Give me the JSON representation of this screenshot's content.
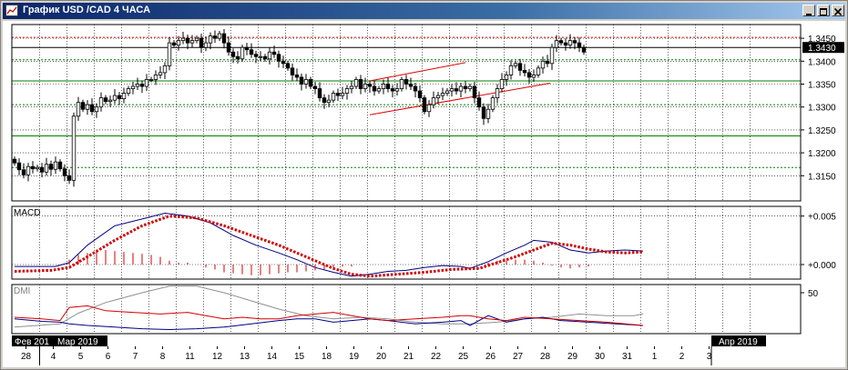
{
  "window": {
    "title": "График USD /CAD  4 ЧАСА",
    "buttons": [
      "minimize-icon",
      "maximize-icon",
      "close-icon"
    ]
  },
  "colors": {
    "background": "#ffffff",
    "bull_candle": "#ffffff",
    "bear_candle": "#000000",
    "resistance_line": "#e00000",
    "support_lines": "#008000",
    "channel_lines": "#e00000",
    "macd_line": "#000080",
    "macd_signal": "#d00000",
    "macd_histogram": "#d00000",
    "dmi_plus": "#000080",
    "dmi_minus": "#d00000",
    "adx": "#909090",
    "current_price_box": "#000000"
  },
  "chart_data": [
    {
      "type": "candlestick",
      "panel": "price",
      "ylim": [
        1.3095,
        1.348
      ],
      "y_ticks": [
        "1.3450",
        "1.3400",
        "1.3350",
        "1.3300",
        "1.3250",
        "1.3200",
        "1.3150"
      ],
      "current_price": "1.3430",
      "horizontal_lines": [
        {
          "value": 1.3452,
          "style": "dotted-red"
        },
        {
          "value": 1.343,
          "style": "solid-black"
        },
        {
          "value": 1.3403,
          "style": "dotted-green"
        },
        {
          "value": 1.3357,
          "style": "solid-green"
        },
        {
          "value": 1.3305,
          "style": "dotted-green"
        },
        {
          "value": 1.3237,
          "style": "solid-green"
        },
        {
          "value": 1.3168,
          "style": "dotted-green"
        }
      ],
      "channel": [
        {
          "from": [
            13.0,
            1.3357
          ],
          "to": [
            16.5,
            1.3397
          ]
        },
        {
          "from": [
            13.0,
            1.3283
          ],
          "to": [
            19.6,
            1.3352
          ]
        }
      ],
      "day_centers": [
        28,
        4,
        5,
        6,
        7,
        8,
        11,
        12,
        13,
        14,
        15,
        18,
        19,
        20,
        21,
        22,
        25,
        26,
        27,
        28,
        29
      ],
      "candles_per_day": 6,
      "closes": [
        1.3178,
        1.3163,
        1.3152,
        1.317,
        1.3165,
        1.3168,
        1.3158,
        1.3175,
        1.3164,
        1.318,
        1.3165,
        1.315,
        1.314,
        1.328,
        1.331,
        1.3295,
        1.3305,
        1.329,
        1.33,
        1.332,
        1.3312,
        1.3315,
        1.3325,
        1.3318,
        1.333,
        1.334,
        1.3345,
        1.335,
        1.3345,
        1.336,
        1.336,
        1.337,
        1.3375,
        1.339,
        1.344,
        1.3435,
        1.3445,
        1.345,
        1.344,
        1.3445,
        1.345,
        1.343,
        1.344,
        1.3455,
        1.345,
        1.346,
        1.344,
        1.342,
        1.341,
        1.3405,
        1.343,
        1.3425,
        1.3415,
        1.341,
        1.341,
        1.3405,
        1.342,
        1.3415,
        1.34,
        1.3395,
        1.3385,
        1.337,
        1.3365,
        1.335,
        1.336,
        1.3345,
        1.334,
        1.332,
        1.331,
        1.3315,
        1.333,
        1.3325,
        1.333,
        1.334,
        1.3345,
        1.336,
        1.334,
        1.335,
        1.3345,
        1.3335,
        1.334,
        1.335,
        1.334,
        1.3335,
        1.334,
        1.336,
        1.335,
        1.3345,
        1.3335,
        1.332,
        1.329,
        1.3305,
        1.332,
        1.3325,
        1.333,
        1.3335,
        1.334,
        1.3335,
        1.3345,
        1.334,
        1.3345,
        1.332,
        1.33,
        1.3275,
        1.3295,
        1.332,
        1.334,
        1.336,
        1.337,
        1.339,
        1.3395,
        1.338,
        1.3375,
        1.3365,
        1.337,
        1.3385,
        1.34,
        1.3395,
        1.343,
        1.3445,
        1.344,
        1.3435,
        1.3445,
        1.344,
        1.343,
        1.342
      ]
    },
    {
      "type": "line",
      "panel": "macd",
      "label": "MACD",
      "ylim": [
        -0.0015,
        0.006
      ],
      "y_ticks": [
        "+0.005",
        "+0.000"
      ],
      "series": [
        {
          "key": "macd",
          "style": "line",
          "points": [
            [
              0,
              -0.0002
            ],
            [
              9,
              -0.0002
            ],
            [
              12,
              0.0002
            ],
            [
              16,
              0.002
            ],
            [
              22,
              0.004
            ],
            [
              28,
              0.0047
            ],
            [
              33,
              0.0053
            ],
            [
              38,
              0.005
            ],
            [
              43,
              0.0043
            ],
            [
              48,
              0.003
            ],
            [
              53,
              0.002
            ],
            [
              58,
              0.0012
            ],
            [
              62,
              0.0005
            ],
            [
              66,
              -0.0003
            ],
            [
              70,
              -0.0008
            ],
            [
              74,
              -0.0012
            ],
            [
              78,
              -0.001
            ],
            [
              82,
              -0.0007
            ],
            [
              86,
              -0.0006
            ],
            [
              90,
              -0.0003
            ],
            [
              94,
              -0.0001
            ],
            [
              98,
              -0.0002
            ],
            [
              100,
              -0.0004
            ],
            [
              104,
              0.0003
            ],
            [
              108,
              0.0012
            ],
            [
              112,
              0.002
            ],
            [
              114,
              0.0025
            ],
            [
              118,
              0.0023
            ],
            [
              122,
              0.0015
            ],
            [
              126,
              0.0012
            ],
            [
              130,
              0.0014
            ],
            [
              134,
              0.0015
            ],
            [
              138,
              0.0014
            ]
          ]
        },
        {
          "key": "signal",
          "style": "dotted",
          "points": [
            [
              0,
              -0.0007
            ],
            [
              8,
              -0.0006
            ],
            [
              12,
              -0.0003
            ],
            [
              16,
              0.0008
            ],
            [
              22,
              0.0025
            ],
            [
              28,
              0.004
            ],
            [
              34,
              0.005
            ],
            [
              40,
              0.0048
            ],
            [
              46,
              0.004
            ],
            [
              52,
              0.003
            ],
            [
              58,
              0.002
            ],
            [
              62,
              0.0012
            ],
            [
              66,
              0.0004
            ],
            [
              70,
              -0.0004
            ],
            [
              74,
              -0.001
            ],
            [
              78,
              -0.0012
            ],
            [
              84,
              -0.001
            ],
            [
              90,
              -0.0008
            ],
            [
              96,
              -0.0005
            ],
            [
              102,
              -0.0004
            ],
            [
              106,
              0.0002
            ],
            [
              110,
              0.0008
            ],
            [
              114,
              0.0015
            ],
            [
              118,
              0.0022
            ],
            [
              122,
              0.002
            ],
            [
              126,
              0.0016
            ],
            [
              130,
              0.0013
            ],
            [
              134,
              0.0012
            ],
            [
              138,
              0.0013
            ]
          ]
        },
        {
          "key": "histogram",
          "style": "bars",
          "points": [
            [
              12,
              0.0005
            ],
            [
              14,
              0.001
            ],
            [
              16,
              0.0012
            ],
            [
              18,
              0.0014
            ],
            [
              20,
              0.0015
            ],
            [
              22,
              0.0014
            ],
            [
              24,
              0.0013
            ],
            [
              26,
              0.0012
            ],
            [
              28,
              0.0011
            ],
            [
              30,
              0.001
            ],
            [
              32,
              0.0008
            ],
            [
              34,
              0.0004
            ],
            [
              36,
              0.0002
            ],
            [
              38,
              0.0002
            ],
            [
              40,
              0.0
            ],
            [
              42,
              -0.0003
            ],
            [
              44,
              -0.0005
            ],
            [
              46,
              -0.0008
            ],
            [
              48,
              -0.0009
            ],
            [
              50,
              -0.001
            ],
            [
              52,
              -0.0011
            ],
            [
              54,
              -0.0011
            ],
            [
              56,
              -0.001
            ],
            [
              58,
              -0.0009
            ],
            [
              60,
              -0.0008
            ],
            [
              62,
              -0.0008
            ],
            [
              64,
              -0.0007
            ],
            [
              66,
              -0.0006
            ],
            [
              68,
              -0.0005
            ],
            [
              70,
              -0.0003
            ],
            [
              72,
              -0.0002
            ],
            [
              74,
              -0.0002
            ],
            [
              104,
              0.0002
            ],
            [
              106,
              0.0004
            ],
            [
              108,
              0.0004
            ],
            [
              110,
              0.0005
            ],
            [
              112,
              0.0005
            ],
            [
              114,
              0.0004
            ],
            [
              116,
              0.0002
            ],
            [
              118,
              -0.0001
            ],
            [
              120,
              -0.0003
            ],
            [
              122,
              -0.0004
            ],
            [
              124,
              -0.0003
            ],
            [
              126,
              -0.0002
            ]
          ]
        }
      ]
    },
    {
      "type": "line",
      "panel": "dmi",
      "label": "DMI",
      "ylim": [
        0,
        60
      ],
      "y_ticks": [
        "50"
      ],
      "series": [
        {
          "key": "adx",
          "points": [
            [
              0,
              8
            ],
            [
              10,
              12
            ],
            [
              14,
              25
            ],
            [
              20,
              38
            ],
            [
              28,
              50
            ],
            [
              34,
              58
            ],
            [
              40,
              58
            ],
            [
              46,
              50
            ],
            [
              52,
              40
            ],
            [
              58,
              30
            ],
            [
              64,
              22
            ],
            [
              70,
              18
            ],
            [
              76,
              20
            ],
            [
              82,
              18
            ],
            [
              88,
              14
            ],
            [
              94,
              12
            ],
            [
              100,
              12
            ],
            [
              106,
              14
            ],
            [
              112,
              18
            ],
            [
              118,
              20
            ],
            [
              124,
              24
            ],
            [
              130,
              22
            ],
            [
              136,
              22
            ],
            [
              138,
              24
            ]
          ]
        },
        {
          "key": "dmi_plus",
          "points": [
            [
              0,
              18
            ],
            [
              6,
              15
            ],
            [
              10,
              14
            ],
            [
              12,
              12
            ],
            [
              16,
              10
            ],
            [
              22,
              8
            ],
            [
              28,
              6
            ],
            [
              34,
              5
            ],
            [
              40,
              6
            ],
            [
              46,
              8
            ],
            [
              52,
              12
            ],
            [
              58,
              16
            ],
            [
              62,
              18
            ],
            [
              66,
              18
            ],
            [
              70,
              14
            ],
            [
              74,
              16
            ],
            [
              78,
              18
            ],
            [
              82,
              16
            ],
            [
              88,
              12
            ],
            [
              94,
              14
            ],
            [
              98,
              16
            ],
            [
              100,
              10
            ],
            [
              104,
              22
            ],
            [
              108,
              14
            ],
            [
              112,
              18
            ],
            [
              116,
              20
            ],
            [
              120,
              16
            ],
            [
              126,
              14
            ],
            [
              132,
              12
            ],
            [
              138,
              10
            ]
          ]
        },
        {
          "key": "dmi_minus",
          "points": [
            [
              0,
              20
            ],
            [
              6,
              18
            ],
            [
              10,
              16
            ],
            [
              12,
              32
            ],
            [
              16,
              34
            ],
            [
              20,
              28
            ],
            [
              26,
              26
            ],
            [
              32,
              24
            ],
            [
              38,
              26
            ],
            [
              42,
              22
            ],
            [
              46,
              18
            ],
            [
              50,
              20
            ],
            [
              54,
              18
            ],
            [
              58,
              18
            ],
            [
              62,
              22
            ],
            [
              66,
              24
            ],
            [
              70,
              26
            ],
            [
              74,
              22
            ],
            [
              78,
              18
            ],
            [
              82,
              16
            ],
            [
              88,
              18
            ],
            [
              94,
              20
            ],
            [
              98,
              22
            ],
            [
              100,
              22
            ],
            [
              104,
              18
            ],
            [
              108,
              16
            ],
            [
              112,
              20
            ],
            [
              118,
              18
            ],
            [
              124,
              16
            ],
            [
              130,
              14
            ],
            [
              138,
              10
            ]
          ]
        }
      ]
    }
  ],
  "time_axis": {
    "month_labels": [
      "Фев 201",
      "Мар 2019",
      "Апр 2019"
    ],
    "day_labels": [
      "28",
      "4",
      "5",
      "6",
      "7",
      "8",
      "11",
      "12",
      "13",
      "14",
      "15",
      "18",
      "19",
      "20",
      "21",
      "22",
      "25",
      "26",
      "27",
      "28",
      "29",
      "30",
      "31",
      "1",
      "2",
      "3"
    ]
  }
}
